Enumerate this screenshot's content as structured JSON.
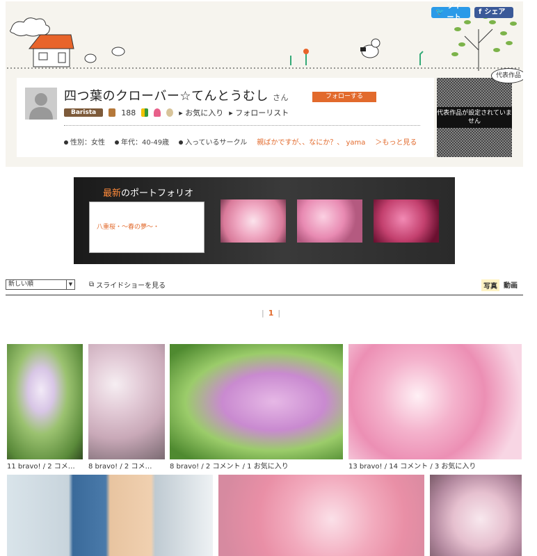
{
  "share": {
    "tweet": "ツイート",
    "facebook": "シェア"
  },
  "profile": {
    "name": "四つ葉のクローバー☆てんとうむし",
    "honorific": "さん",
    "follow_label": "フォローする",
    "rank": "Barista",
    "points": "188",
    "favorites_link": "お気に入り",
    "follow_list_link": "フォローリスト",
    "gender": "性別：女性",
    "age": "年代：40-49歳",
    "circle_label": "入っているサークル",
    "circles": "親ばかですが、、なにか？、 yama",
    "more": "＞もっと見る"
  },
  "representative": {
    "bubble": "代表作品",
    "empty_label": "代表作品が設定されていません"
  },
  "portfolio": {
    "title_highlight": "最新",
    "title_rest": "のポートフォリオ",
    "caption": "八重桜・～春の夢～・"
  },
  "controls": {
    "sort_value": "新しい順",
    "slideshow": "スライドショーを見る",
    "tab_photo": "写真",
    "tab_video": "動画"
  },
  "pager": {
    "current": "1"
  },
  "photos": [
    {
      "bravo": "11",
      "stat": "11 bravo! / 2 コメ…"
    },
    {
      "bravo": "8",
      "stat": "8 bravo! / 2 コメ…"
    },
    {
      "bravo": "8",
      "stat": "8 bravo! / 2 コメント / 1 お気に入り"
    },
    {
      "bravo": "13",
      "stat": "13 bravo! / 14 コメント / 3 お気に入り"
    }
  ],
  "colors": {
    "accent": "#e26a2c",
    "twitter": "#2b9ae8",
    "facebook": "#3b5998"
  }
}
